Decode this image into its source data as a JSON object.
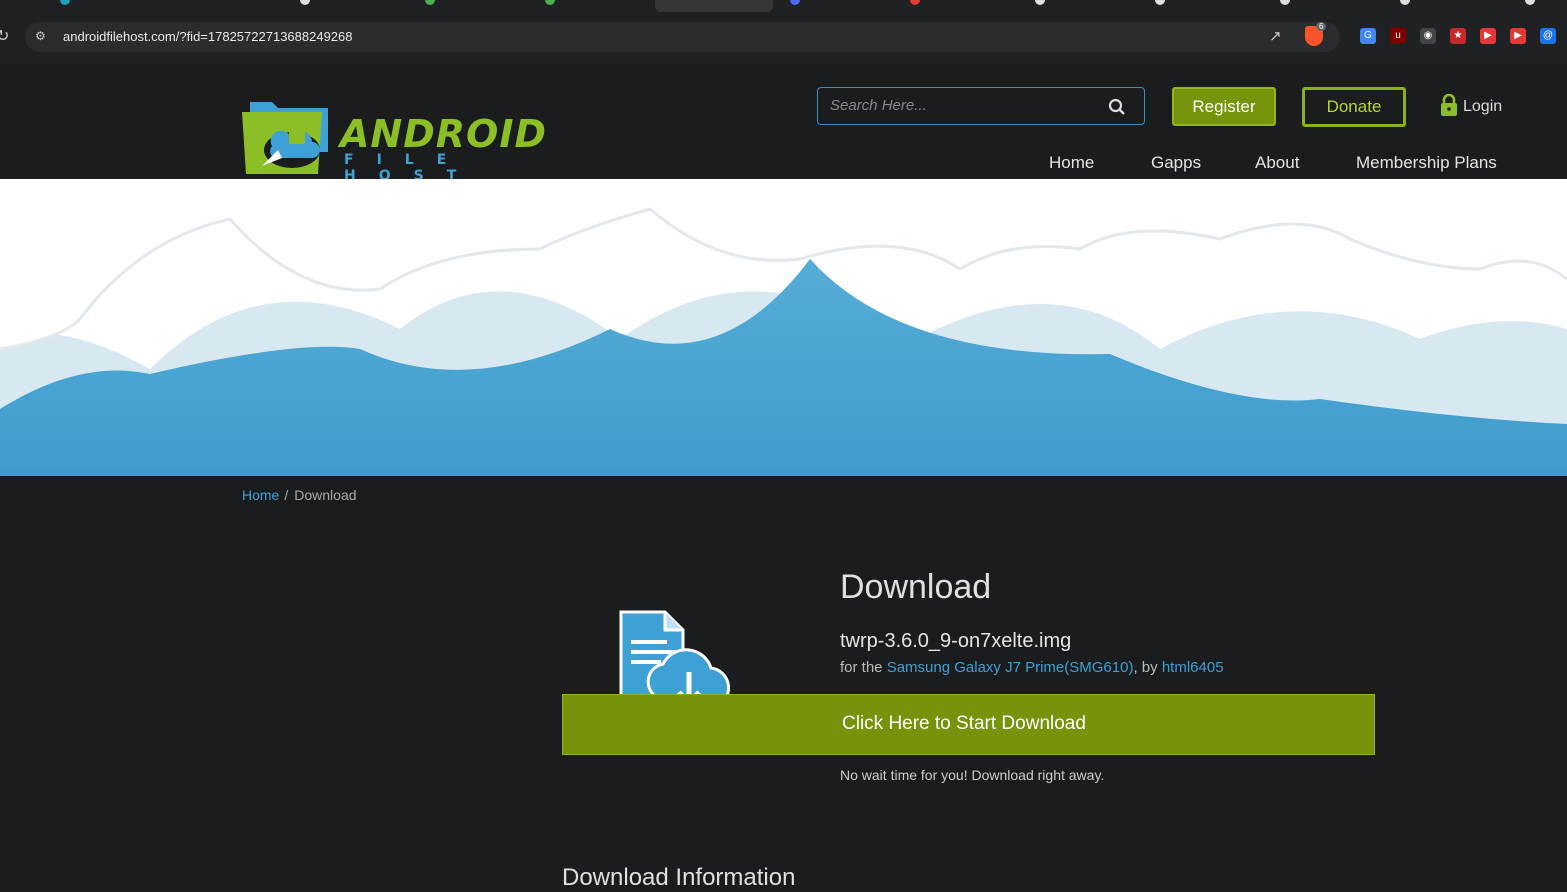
{
  "browser": {
    "url": "androidfilehost.com/?fid=17825722713688249268",
    "brave_badge": "6"
  },
  "header": {
    "logo_word": "ANDROID",
    "logo_sub": "FILE HOST",
    "search_placeholder": "Search Here...",
    "register_label": "Register",
    "donate_label": "Donate",
    "login_label": "Login",
    "nav": [
      "Home",
      "Gapps",
      "About",
      "Membership Plans"
    ]
  },
  "breadcrumb": {
    "home": "Home",
    "separator": "/",
    "current": "Download"
  },
  "download": {
    "title": "Download",
    "filename": "twrp-3.6.0_9-on7xelte.img",
    "for_prefix": "for the ",
    "device": "Samsung Galaxy J7 Prime(SMG610)",
    "by_text": ", by ",
    "author": "html6405",
    "button_label": "Click Here to Start Download",
    "note": "No wait time for you! Download right away.",
    "info_heading": "Download Information"
  },
  "colors": {
    "accent_green": "#76930b",
    "link_blue": "#3fa0d6",
    "background": "#1b1c1e"
  }
}
